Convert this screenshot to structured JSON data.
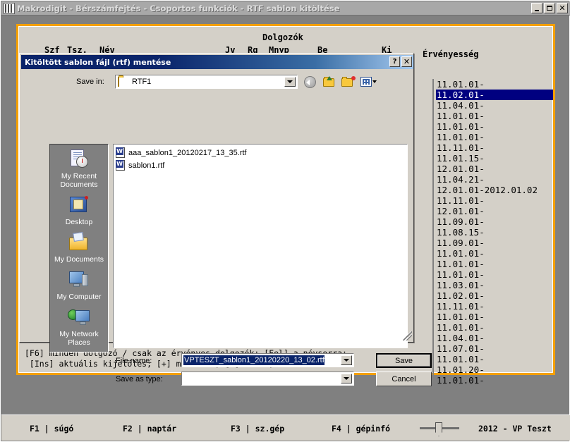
{
  "window": {
    "title": "Makrodigit - Bérszámfejtés  - Csoportos funkciók - RTF sablon kitöltése",
    "minimize_label": "_",
    "maximize_label": "□",
    "close_label": "×"
  },
  "grid": {
    "title": "Dolgozók",
    "headers": {
      "szf": "Szf",
      "tsz": "Tsz.",
      "nev": "Név",
      "jv": "Jv",
      "rg": "Rg",
      "mnyp": "Mnyp",
      "be": "Be",
      "ki": "Ki",
      "ervenyesseg": "Érvényesség"
    },
    "validity_rows": [
      {
        "text": "11.01.01-",
        "selected": false
      },
      {
        "text": "11.02.01-",
        "selected": true
      },
      {
        "text": "11.04.01-",
        "selected": false
      },
      {
        "text": "11.01.01-",
        "selected": false
      },
      {
        "text": "11.01.01-",
        "selected": false
      },
      {
        "text": "11.01.01-",
        "selected": false
      },
      {
        "text": "11.11.01-",
        "selected": false
      },
      {
        "text": "11.01.15-",
        "selected": false
      },
      {
        "text": "12.01.01-",
        "selected": false
      },
      {
        "text": "11.04.21-",
        "selected": false
      },
      {
        "text": "12.01.01-2012.01.02",
        "selected": false
      },
      {
        "text": "11.11.01-",
        "selected": false
      },
      {
        "text": "12.01.01-",
        "selected": false
      },
      {
        "text": "11.09.01-",
        "selected": false
      },
      {
        "text": "11.08.15-",
        "selected": false
      },
      {
        "text": "11.09.01-",
        "selected": false
      },
      {
        "text": "11.01.01-",
        "selected": false
      },
      {
        "text": "11.01.01-",
        "selected": false
      },
      {
        "text": "11.01.01-",
        "selected": false
      },
      {
        "text": "11.03.01-",
        "selected": false
      },
      {
        "text": "11.02.01-",
        "selected": false
      },
      {
        "text": "11.11.01-",
        "selected": false
      },
      {
        "text": "11.01.01-",
        "selected": false
      },
      {
        "text": "11.01.01-",
        "selected": false
      },
      {
        "text": "11.04.01-",
        "selected": false
      },
      {
        "text": "11.07.01-",
        "selected": false
      },
      {
        "text": "11.01.01-",
        "selected": false
      },
      {
        "text": "11.01.20-",
        "selected": false
      },
      {
        "text": "11.01.01-",
        "selected": false
      }
    ]
  },
  "hints": {
    "line1": "[F6] minden dolgozó / csak az érvényes dolgozók; [Fel] a névsorra;",
    "line2": " [Ins] aktuális kijelölés; [+] mindenki; [-] senki;"
  },
  "statusbar": {
    "f1": "F1 | súgó",
    "f2": "F2 | naptár",
    "f3": "F3 | sz.gép",
    "f4": "F4 | gépinfó",
    "year": "2012 - VP Teszt"
  },
  "dialog": {
    "title": "Kitöltött sablon fájl (rtf) mentése",
    "help_label": "?",
    "close_label": "×",
    "save_in_label": "Save in:",
    "save_in_value": "RTF1",
    "toolbar": {
      "back": "back-icon",
      "up": "up-one-level-icon",
      "new_folder": "create-new-folder-icon",
      "views": "views-icon"
    },
    "places": [
      {
        "label": "My Recent\nDocuments",
        "icon": "recent-documents-icon"
      },
      {
        "label": "Desktop",
        "icon": "desktop-icon"
      },
      {
        "label": "My Documents",
        "icon": "my-documents-icon"
      },
      {
        "label": "My Computer",
        "icon": "my-computer-icon"
      },
      {
        "label": "My Network\nPlaces",
        "icon": "my-network-places-icon"
      }
    ],
    "files": [
      {
        "name": "aaa_sablon1_20120217_13_35.rtf",
        "icon": "rtf-document-icon"
      },
      {
        "name": "sablon1.rtf",
        "icon": "rtf-document-icon"
      }
    ],
    "file_name_label": "File name:",
    "file_name_value": "VPTESZT_sablon1_20120220_13_02.rtf",
    "save_as_type_label": "Save as type:",
    "save_as_type_value": "",
    "save_button": "Save",
    "cancel_button": "Cancel"
  },
  "colors": {
    "accent_orange": "#f4a000",
    "selection_blue": "#000080",
    "titlebar_blue": "#0a246a",
    "panel_gray": "#d4d0c8",
    "desktop_gray": "#808080"
  }
}
